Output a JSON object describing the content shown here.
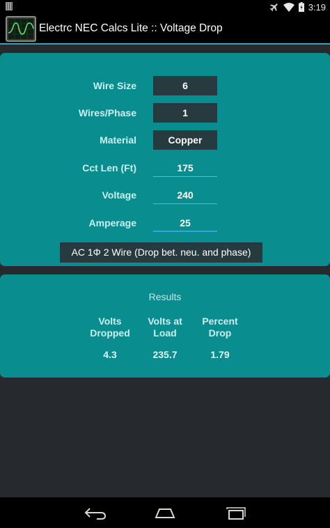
{
  "status_bar": {
    "time": "3:19",
    "icons": [
      "notification-icon",
      "airplane-mode-icon",
      "wifi-icon",
      "battery-icon"
    ]
  },
  "action_bar": {
    "title": "Electrc NEC Calcs Lite :: Voltage Drop",
    "app_icon": "oscilloscope-icon"
  },
  "inputs": {
    "wire_size": {
      "label": "Wire Size",
      "value": "6"
    },
    "wires_per_phase": {
      "label": "Wires/Phase",
      "value": "1"
    },
    "material": {
      "label": "Material",
      "value": "Copper"
    },
    "circuit_length": {
      "label": "Cct Len (Ft)",
      "value": "175"
    },
    "voltage": {
      "label": "Voltage",
      "value": "240"
    },
    "amperage": {
      "label": "Amperage",
      "value": "25"
    },
    "circuit_type": "AC 1Φ 2 Wire (Drop bet. neu. and phase)"
  },
  "results": {
    "title": "Results",
    "volts_dropped": {
      "label_line1": "Volts",
      "label_line2": "Dropped",
      "value": "4.3"
    },
    "volts_at_load": {
      "label_line1": "Volts at",
      "label_line2": "Load",
      "value": "235.7"
    },
    "percent_drop": {
      "label_line1": "Percent",
      "label_line2": "Drop",
      "value": "1.79"
    }
  },
  "nav_bar": {
    "icons": [
      "back-icon",
      "home-icon",
      "recent-apps-icon"
    ]
  },
  "colors": {
    "panel": "#0a8d8f",
    "field_box": "#263a3f",
    "accent": "#35a0c6",
    "background": "#26292e"
  }
}
